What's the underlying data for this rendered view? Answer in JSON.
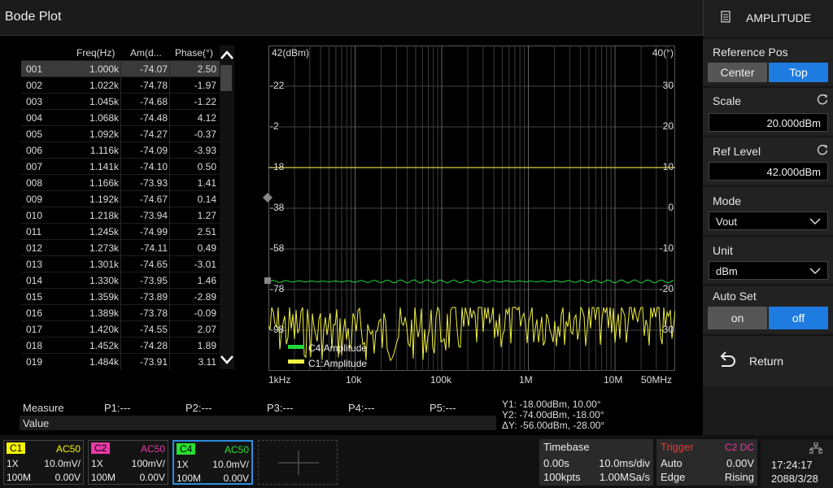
{
  "title": "Bode Plot",
  "table": {
    "headers": [
      "Freq(Hz)",
      "Am(d...",
      "Phase(°)"
    ],
    "rows": [
      [
        "001",
        "1.000k",
        "-74.07",
        "2.50"
      ],
      [
        "002",
        "1.022k",
        "-74.78",
        "-1.97"
      ],
      [
        "003",
        "1.045k",
        "-74.68",
        "-1.22"
      ],
      [
        "004",
        "1.068k",
        "-74.48",
        "4.12"
      ],
      [
        "005",
        "1.092k",
        "-74.27",
        "-0.37"
      ],
      [
        "006",
        "1.116k",
        "-74.09",
        "-3.93"
      ],
      [
        "007",
        "1.141k",
        "-74.10",
        "0.50"
      ],
      [
        "008",
        "1.166k",
        "-73.93",
        "1.41"
      ],
      [
        "009",
        "1.192k",
        "-74.67",
        "0.14"
      ],
      [
        "010",
        "1.218k",
        "-73.94",
        "1.27"
      ],
      [
        "011",
        "1.245k",
        "-74.99",
        "2.51"
      ],
      [
        "012",
        "1.273k",
        "-74.11",
        "0.49"
      ],
      [
        "013",
        "1.301k",
        "-74.65",
        "-3.01"
      ],
      [
        "014",
        "1.330k",
        "-73.95",
        "1.46"
      ],
      [
        "015",
        "1.359k",
        "-73.89",
        "-2.89"
      ],
      [
        "016",
        "1.389k",
        "-73.78",
        "-0.09"
      ],
      [
        "017",
        "1.420k",
        "-74.55",
        "2.07"
      ],
      [
        "018",
        "1.452k",
        "-74.28",
        "1.89"
      ],
      [
        "019",
        "1.484k",
        "-73.91",
        "3.11"
      ]
    ]
  },
  "plot": {
    "left_top_label": "42(dBm)",
    "right_top_label": "40(°)",
    "left_ticks": [
      "-22",
      "-2",
      "-18",
      "-38",
      "-58",
      "-78",
      "-98"
    ],
    "right_ticks": [
      "30",
      "20",
      "10",
      "0",
      "-10",
      "-20",
      "-30"
    ],
    "x_ticks": [
      "1kHz",
      "10k",
      "100k",
      "1M",
      "10M",
      "50MHz"
    ],
    "legend": [
      "C4:Amplitude",
      "C1:Amplitude"
    ],
    "colors": {
      "c4": "#22d83a",
      "c1": "#f0f040",
      "cursor": "#e0d040"
    }
  },
  "measure": {
    "measure_label": "Measure",
    "value_label": "Value",
    "p1": "P1:---",
    "p2": "P2:---",
    "p3": "P3:---",
    "p4": "P4:---",
    "p5": "P5:---",
    "y1": "Y1: -18.00dBm, 10.00°",
    "y2": "Y2: -74.00dBm, -18.00°",
    "dy": "ΔY: -56.00dBm, -28.00°"
  },
  "panel": {
    "header": "AMPLITUDE",
    "refpos_label": "Reference Pos",
    "refpos_center": "Center",
    "refpos_top": "Top",
    "scale_label": "Scale",
    "scale_value": "20.000dBm",
    "reflevel_label": "Ref Level",
    "reflevel_value": "42.000dBm",
    "mode_label": "Mode",
    "mode_value": "Vout",
    "unit_label": "Unit",
    "unit_value": "dBm",
    "autoset_label": "Auto Set",
    "autoset_on": "on",
    "autoset_off": "off",
    "return_label": "Return"
  },
  "channels": [
    {
      "name": "C1",
      "coupling": "AC50",
      "probe": "1X",
      "scale": "10.0mV/",
      "bw": "100M",
      "offset": "0.00V",
      "color": "#f5f500"
    },
    {
      "name": "C2",
      "coupling": "AC50",
      "probe": "1X",
      "scale": "100mV/",
      "bw": "100M",
      "offset": "0.00V",
      "color": "#e83aa8"
    },
    {
      "name": "C4",
      "coupling": "AC50",
      "probe": "1X",
      "scale": "10.0mV/",
      "bw": "100M",
      "offset": "0.00V",
      "color": "#27e030"
    }
  ],
  "timebase": {
    "label": "Timebase",
    "delay": "0.00s",
    "scale": "10.0ms/div",
    "points": "100kpts",
    "rate": "1.00MSa/s"
  },
  "trigger": {
    "label": "Trigger",
    "source": "C2 DC",
    "mode": "Auto",
    "level": "0.00V",
    "type": "Edge",
    "slope": "Rising"
  },
  "clock": {
    "time": "17:24:17",
    "date": "2088/3/28"
  }
}
